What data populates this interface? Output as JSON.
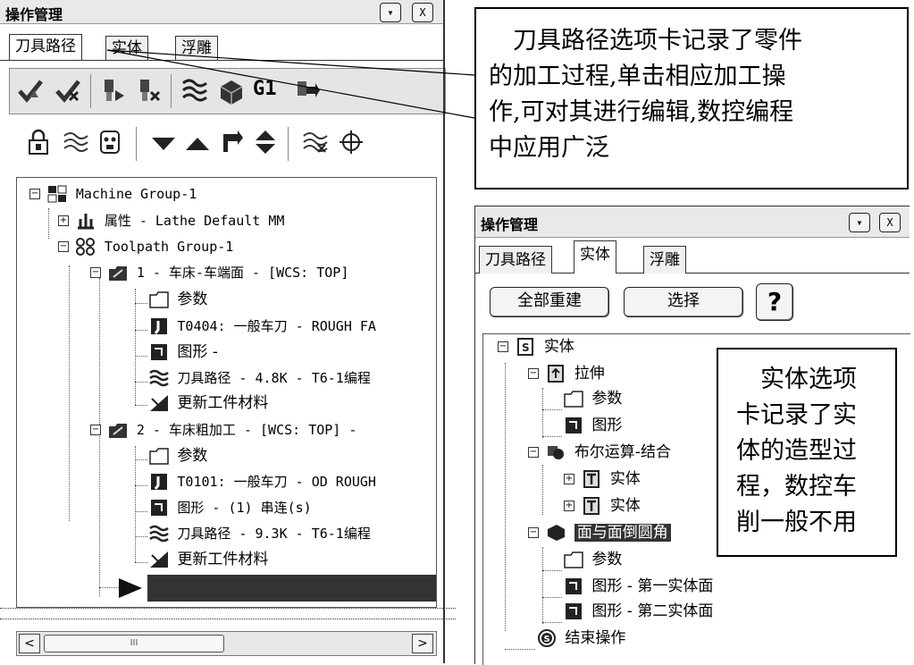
{
  "left": {
    "title": "操作管理",
    "tabs": [
      "刀具路径",
      "实体",
      "浮雕"
    ],
    "tree": [
      {
        "text": "Machine Group-1"
      },
      {
        "text": "属性 - Lathe Default MM"
      },
      {
        "text": "Toolpath Group-1"
      },
      {
        "text": "1 - 车床-车端面 - [WCS: TOP]"
      },
      {
        "text": "参数"
      },
      {
        "text": "T0404: 一般车刀 - ROUGH FA"
      },
      {
        "text": "图形 -"
      },
      {
        "text": "刀具路径 - 4.8K - T6-1编程"
      },
      {
        "text": "更新工件材料"
      },
      {
        "text": "2 - 车床粗加工 - [WCS: TOP] -"
      },
      {
        "text": "参数"
      },
      {
        "text": "T0101: 一般车刀 - OD ROUGH"
      },
      {
        "text": "图形 - (1) 串连(s)"
      },
      {
        "text": "刀具路径 - 9.3K - T6-1编程"
      },
      {
        "text": "更新工件材料"
      }
    ],
    "scroll_thumb_label": "III"
  },
  "callout_top": {
    "text": "刀具路径选项卡记录了零件的加工过程,单击相应加工操作,可对其进行编辑,数控编程中应用广泛",
    "lines": [
      "　刀具路径选项卡记录了零件",
      "的加工过程,单击相应加工操",
      "作,可对其进行编辑,数控编程",
      "中应用广泛"
    ]
  },
  "right": {
    "title": "操作管理",
    "tabs": [
      "刀具路径",
      "实体",
      "浮雕"
    ],
    "buttons": {
      "rebuild_all": "全部重建",
      "select": "选择",
      "help": "?"
    },
    "tree": [
      {
        "text": "实体"
      },
      {
        "text": "拉伸"
      },
      {
        "text": "参数"
      },
      {
        "text": "图形"
      },
      {
        "text": "布尔运算-结合"
      },
      {
        "text": "实体"
      },
      {
        "text": "实体"
      },
      {
        "text": "面与面倒圆角"
      },
      {
        "text": "参数"
      },
      {
        "text": "图形 - 第一实体面"
      },
      {
        "text": "图形 - 第二实体面"
      },
      {
        "text": "结束操作"
      }
    ]
  },
  "callout_right": {
    "lines": [
      "　实体选项",
      "卡记录了实",
      "体的造型过",
      "程，数控车",
      "削一般不用"
    ]
  },
  "winbtn": {
    "min": "▾",
    "close": "X"
  }
}
